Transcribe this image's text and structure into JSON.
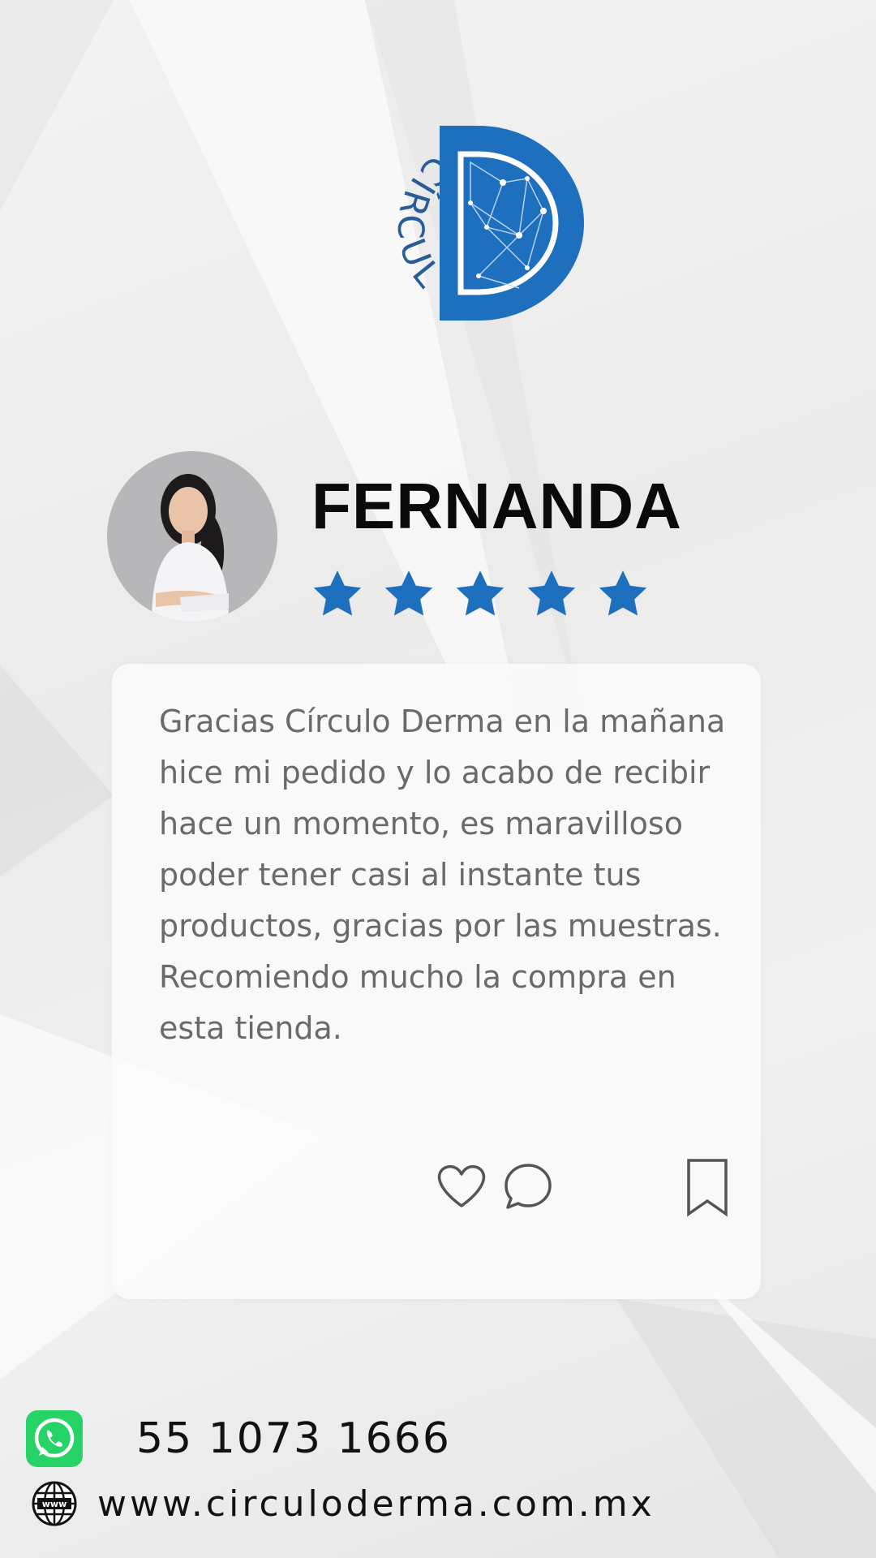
{
  "brand": {
    "name_arc": "CÍRCULO",
    "accent_color": "#1f6fbf"
  },
  "reviewer": {
    "name": "FERNANDA",
    "rating": 5,
    "rating_max": 5
  },
  "review": {
    "text": "Gracias Círculo Derma en la mañana hice mi pedido y lo acabo de recibir hace un momento, es maravilloso poder tener casi al instante tus productos, gracias por las muestras.\nRecomiendo mucho la compra en esta tienda."
  },
  "actions": {
    "like_icon": "heart-icon",
    "comment_icon": "comment-icon",
    "save_icon": "bookmark-icon"
  },
  "contact": {
    "phone": "55 1073 1666",
    "website": "www.circuloderma.com.mx",
    "whatsapp_color": "#25d366"
  }
}
